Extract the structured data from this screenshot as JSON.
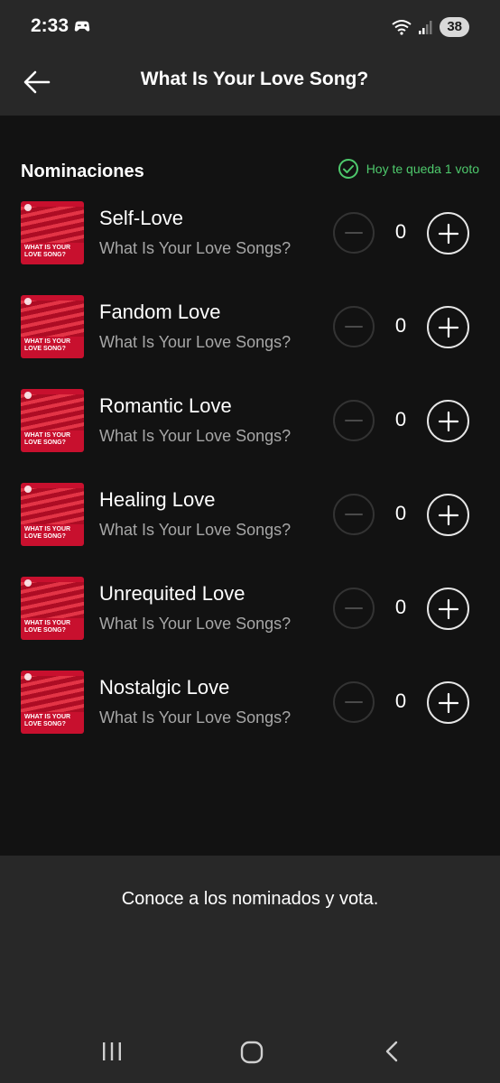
{
  "status": {
    "time": "2:33",
    "battery": "38"
  },
  "header": {
    "title": "What Is Your Love Song?"
  },
  "section": {
    "title": "Nominaciones",
    "votes_remaining": "Hoy te queda 1 voto"
  },
  "cover_text": "WHAT IS YOUR LOVE SONG?",
  "nominations": [
    {
      "title": "Self-Love",
      "subtitle": "What Is Your Love Songs?",
      "votes": "0"
    },
    {
      "title": "Fandom Love",
      "subtitle": "What Is Your Love Songs?",
      "votes": "0"
    },
    {
      "title": "Romantic Love",
      "subtitle": "What Is Your Love Songs?",
      "votes": "0"
    },
    {
      "title": "Healing Love",
      "subtitle": "What Is Your Love Songs?",
      "votes": "0"
    },
    {
      "title": "Unrequited Love",
      "subtitle": "What Is Your Love Songs?",
      "votes": "0"
    },
    {
      "title": "Nostalgic Love",
      "subtitle": "What Is Your Love Songs?",
      "votes": "0"
    }
  ],
  "footer": {
    "text": "Conoce a los nominados y vota."
  },
  "colors": {
    "accent_green": "#4ec96c",
    "background": "#121212",
    "panel": "#282828",
    "cover_red": "#c8102e"
  },
  "icons": {
    "back": "arrow-left-icon",
    "check": "check-circle-icon",
    "minus": "minus-icon",
    "plus": "plus-icon",
    "nav_recent": "recent-apps-icon",
    "nav_home": "home-icon",
    "nav_back": "chevron-left-icon"
  }
}
